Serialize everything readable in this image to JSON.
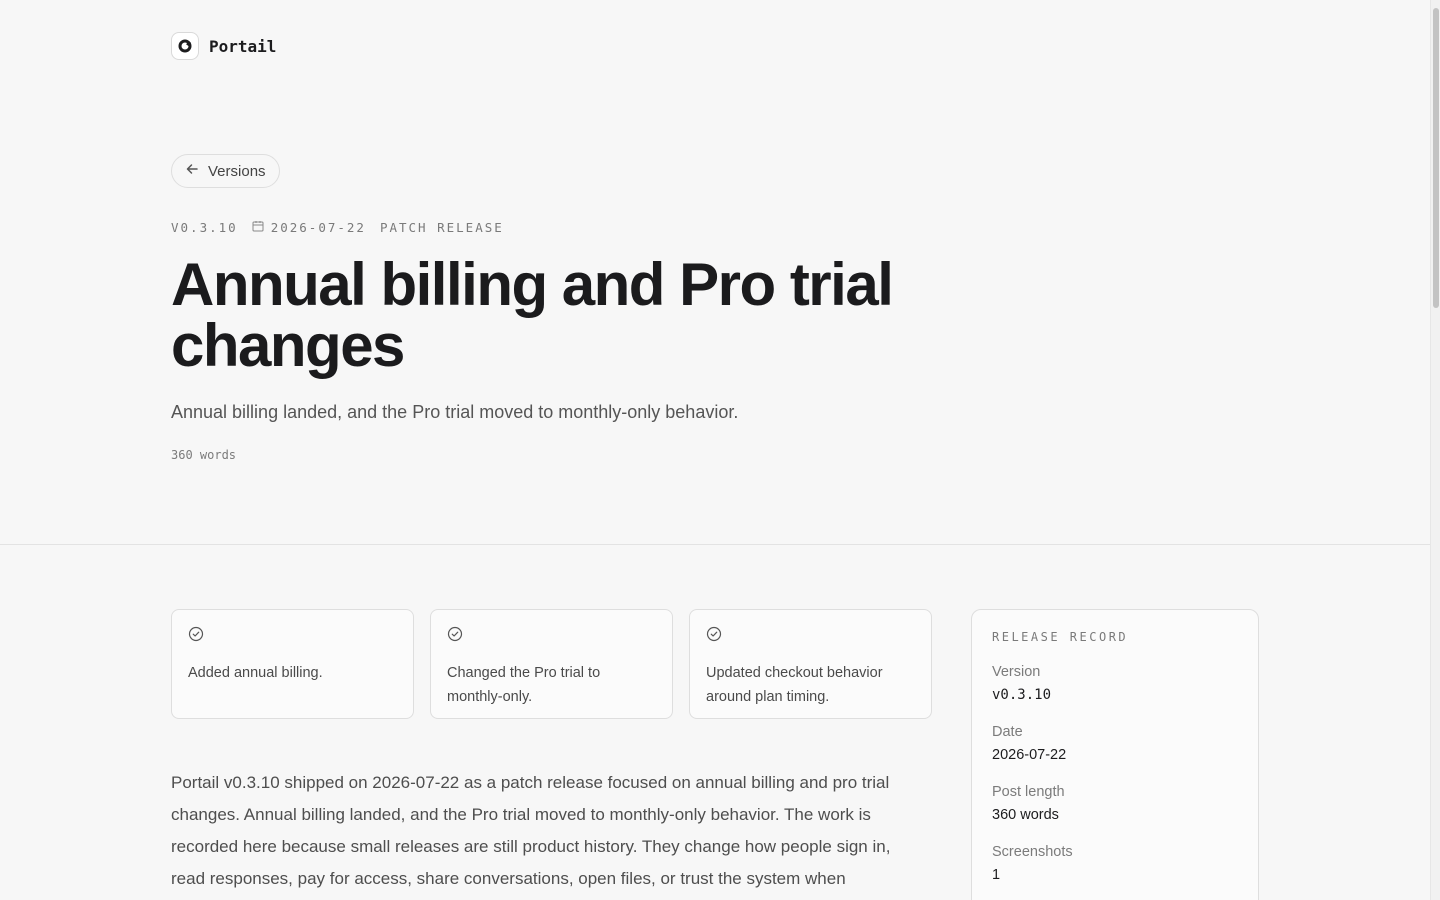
{
  "brand": {
    "name": "Portail"
  },
  "nav": {
    "back_label": "Versions"
  },
  "post": {
    "version": "v0.3.10",
    "date": "2026-07-22",
    "release_type": "PATCH RELEASE",
    "title": "Annual billing and Pro trial changes",
    "summary": "Annual billing landed, and the Pro trial moved to monthly-only behavior.",
    "word_count": "360 words",
    "body": "Portail v0.3.10 shipped on 2026-07-22 as a patch release focused on annual billing and pro trial changes. Annual billing landed, and the Pro trial moved to monthly-only behavior. The work is recorded here because small releases are still product history. They change how people sign in, read responses, pay for access, share conversations, open files, or trust the system when"
  },
  "highlights": [
    {
      "text": "Added annual billing."
    },
    {
      "text": "Changed the Pro trial to monthly-only."
    },
    {
      "text": "Updated checkout behavior around plan timing."
    }
  ],
  "record": {
    "heading": "RELEASE RECORD",
    "items": [
      {
        "label": "Version",
        "value": "v0.3.10"
      },
      {
        "label": "Date",
        "value": "2026-07-22"
      },
      {
        "label": "Post length",
        "value": "360 words"
      },
      {
        "label": "Screenshots",
        "value": "1"
      }
    ]
  }
}
